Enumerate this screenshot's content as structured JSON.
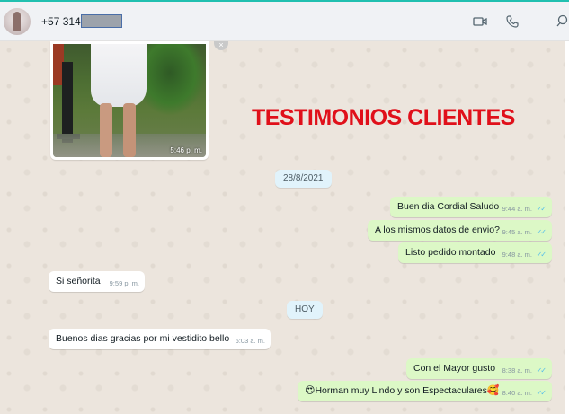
{
  "header": {
    "contact_phone": "+57 314",
    "icons": [
      "video-call-icon",
      "voice-call-icon",
      "search-icon"
    ]
  },
  "photo_message": {
    "time": "5:46 p. m."
  },
  "banner": {
    "text": "TESTIMONIOS CLIENTES",
    "color": "#e0101a"
  },
  "date_chips": [
    {
      "label": "28/8/2021"
    },
    {
      "label": "HOY"
    }
  ],
  "messages": [
    {
      "direction": "outgoing",
      "text": "Buen dia Cordial Saludo",
      "time": "9:44 a. m.",
      "ticks": "✓✓"
    },
    {
      "direction": "outgoing",
      "text": "A los mismos datos de envio?",
      "time": "9:45 a. m.",
      "ticks": "✓✓"
    },
    {
      "direction": "outgoing",
      "text": "Listo pedido montado",
      "time": "9:48 a. m.",
      "ticks": "✓✓"
    },
    {
      "direction": "incoming",
      "text": "Si señorita",
      "time": "9:59 p. m."
    },
    {
      "direction": "incoming",
      "text": "Buenos dias gracias por mi vestidito bello",
      "time": "6:03 a. m."
    },
    {
      "direction": "outgoing",
      "text": "Con el Mayor gusto",
      "time": "8:38 a. m.",
      "ticks": "✓✓"
    },
    {
      "direction": "outgoing",
      "text": "Horman muy Lindo y son Espectaculares",
      "emoji_before": "😍",
      "emoji_after": "🥰",
      "time": "8:40 a. m.",
      "ticks": "✓✓"
    }
  ],
  "colors": {
    "outgoing_bubble": "#dcf8c6",
    "incoming_bubble": "#ffffff",
    "date_chip": "#e1f3fb",
    "read_ticks": "#53bdeb",
    "wallpaper": "#ece5dd"
  }
}
